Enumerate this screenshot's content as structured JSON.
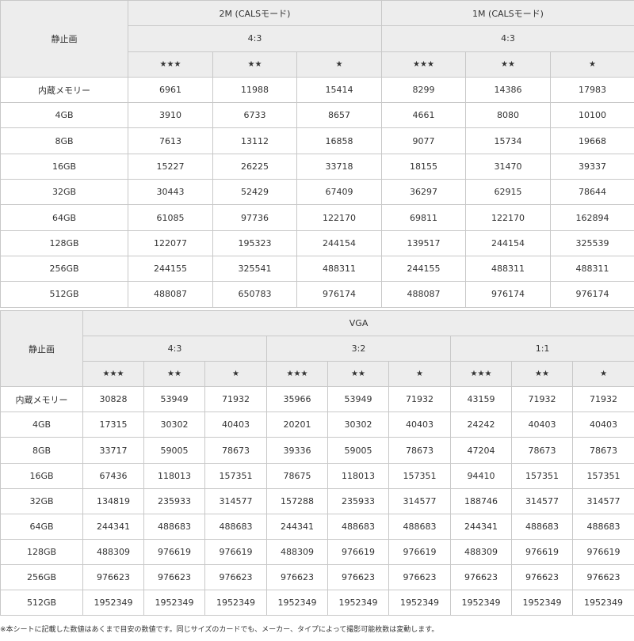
{
  "table1": {
    "corner_label": "静止画",
    "groups": [
      {
        "label": "2M (CALSモード)",
        "aspect": "4:3",
        "stars": [
          "★★★",
          "★★",
          "★"
        ]
      },
      {
        "label": "1M (CALSモード)",
        "aspect": "4:3",
        "stars": [
          "★★★",
          "★★",
          "★"
        ]
      }
    ],
    "rows": [
      {
        "label": "内蔵メモリー",
        "values": [
          "6961",
          "11988",
          "15414",
          "8299",
          "14386",
          "17983"
        ]
      },
      {
        "label": "4GB",
        "values": [
          "3910",
          "6733",
          "8657",
          "4661",
          "8080",
          "10100"
        ]
      },
      {
        "label": "8GB",
        "values": [
          "7613",
          "13112",
          "16858",
          "9077",
          "15734",
          "19668"
        ]
      },
      {
        "label": "16GB",
        "values": [
          "15227",
          "26225",
          "33718",
          "18155",
          "31470",
          "39337"
        ]
      },
      {
        "label": "32GB",
        "values": [
          "30443",
          "52429",
          "67409",
          "36297",
          "62915",
          "78644"
        ]
      },
      {
        "label": "64GB",
        "values": [
          "61085",
          "97736",
          "122170",
          "69811",
          "122170",
          "162894"
        ]
      },
      {
        "label": "128GB",
        "values": [
          "122077",
          "195323",
          "244154",
          "139517",
          "244154",
          "325539"
        ]
      },
      {
        "label": "256GB",
        "values": [
          "244155",
          "325541",
          "488311",
          "244155",
          "488311",
          "488311"
        ]
      },
      {
        "label": "512GB",
        "values": [
          "488087",
          "650783",
          "976174",
          "488087",
          "976174",
          "976174"
        ]
      }
    ]
  },
  "table2": {
    "corner_label": "静止画",
    "group_label": "VGA",
    "aspects": [
      "4:3",
      "3:2",
      "1:1"
    ],
    "stars": [
      "★★★",
      "★★",
      "★",
      "★★★",
      "★★",
      "★",
      "★★★",
      "★★",
      "★"
    ],
    "rows": [
      {
        "label": "内蔵メモリー",
        "values": [
          "30828",
          "53949",
          "71932",
          "35966",
          "53949",
          "71932",
          "43159",
          "71932",
          "71932"
        ]
      },
      {
        "label": "4GB",
        "values": [
          "17315",
          "30302",
          "40403",
          "20201",
          "30302",
          "40403",
          "24242",
          "40403",
          "40403"
        ]
      },
      {
        "label": "8GB",
        "values": [
          "33717",
          "59005",
          "78673",
          "39336",
          "59005",
          "78673",
          "47204",
          "78673",
          "78673"
        ]
      },
      {
        "label": "16GB",
        "values": [
          "67436",
          "118013",
          "157351",
          "78675",
          "118013",
          "157351",
          "94410",
          "157351",
          "157351"
        ]
      },
      {
        "label": "32GB",
        "values": [
          "134819",
          "235933",
          "314577",
          "157288",
          "235933",
          "314577",
          "188746",
          "314577",
          "314577"
        ]
      },
      {
        "label": "64GB",
        "values": [
          "244341",
          "488683",
          "488683",
          "244341",
          "488683",
          "488683",
          "244341",
          "488683",
          "488683"
        ]
      },
      {
        "label": "128GB",
        "values": [
          "488309",
          "976619",
          "976619",
          "488309",
          "976619",
          "976619",
          "488309",
          "976619",
          "976619"
        ]
      },
      {
        "label": "256GB",
        "values": [
          "976623",
          "976623",
          "976623",
          "976623",
          "976623",
          "976623",
          "976623",
          "976623",
          "976623"
        ]
      },
      {
        "label": "512GB",
        "values": [
          "1952349",
          "1952349",
          "1952349",
          "1952349",
          "1952349",
          "1952349",
          "1952349",
          "1952349",
          "1952349"
        ]
      }
    ]
  },
  "footnote": "※本シートに記載した数値はあくまで目安の数値です。同じサイズのカードでも、メーカー、タイプによって撮影可能枚数は変動します。",
  "colors": {
    "header_bg": "#ededed",
    "border": "#c8c8c8",
    "text": "#333333"
  }
}
